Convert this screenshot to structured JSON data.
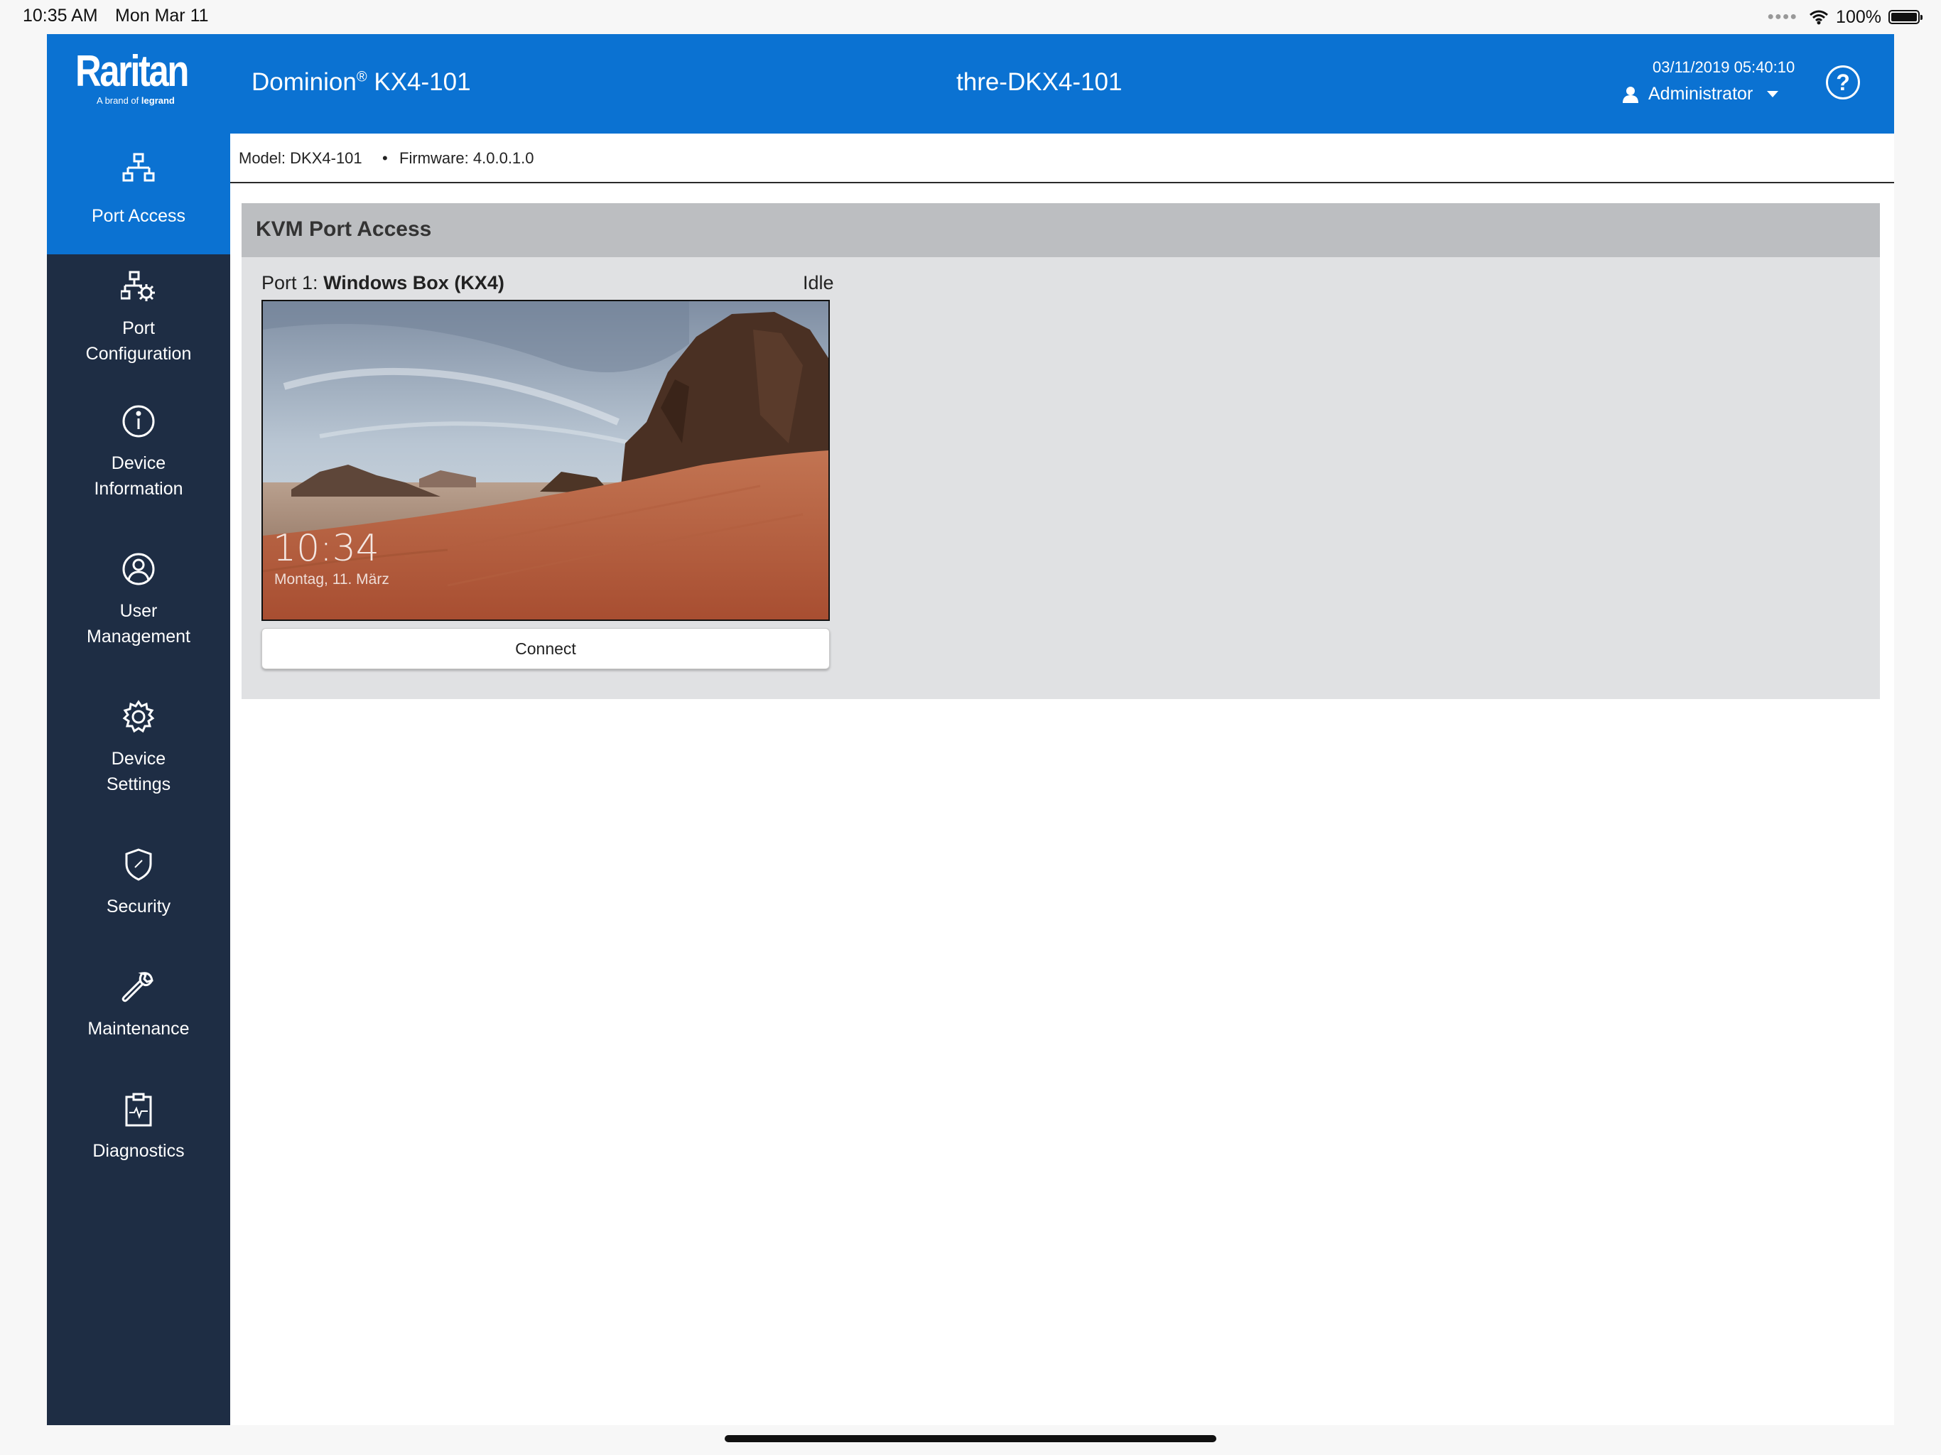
{
  "status_bar": {
    "time": "10:35 AM",
    "date": "Mon Mar 11",
    "battery": "100%",
    "battery_level": 1.0
  },
  "header": {
    "brand": "Raritan",
    "brand_sub_prefix": "A brand of",
    "brand_sub_name": "legrand",
    "product_name": "Dominion",
    "product_mark": "®",
    "product_model": "KX4-101",
    "hostname": "thre-DKX4-101",
    "datetime": "03/11/2019 05:40:10",
    "user": "Administrator",
    "help_glyph": "?"
  },
  "sidebar": {
    "items": [
      {
        "label": "Port Access",
        "icon": "network-icon",
        "active": true
      },
      {
        "label": "Port Configuration",
        "icon": "network-gear-icon"
      },
      {
        "label": "Device Information",
        "icon": "info-icon"
      },
      {
        "label": "User Management",
        "icon": "user-circle-icon"
      },
      {
        "label": "Device Settings",
        "icon": "gear-icon"
      },
      {
        "label": "Security",
        "icon": "shield-icon"
      },
      {
        "label": "Maintenance",
        "icon": "wrench-icon"
      },
      {
        "label": "Diagnostics",
        "icon": "clipboard-pulse-icon"
      }
    ],
    "active_color": "#0b72d2",
    "background": "#1e2d44"
  },
  "info": {
    "model": "Model: DKX4-101",
    "separator": "•",
    "firmware": "Firmware: 4.0.0.1.0"
  },
  "panel": {
    "title": "KVM Port Access",
    "port": {
      "prefix": "Port 1:",
      "name": "Windows Box (KX4)",
      "status": "Idle",
      "preview_time": "10:34",
      "preview_date": "Montag, 11. März",
      "connect_label": "Connect"
    }
  }
}
